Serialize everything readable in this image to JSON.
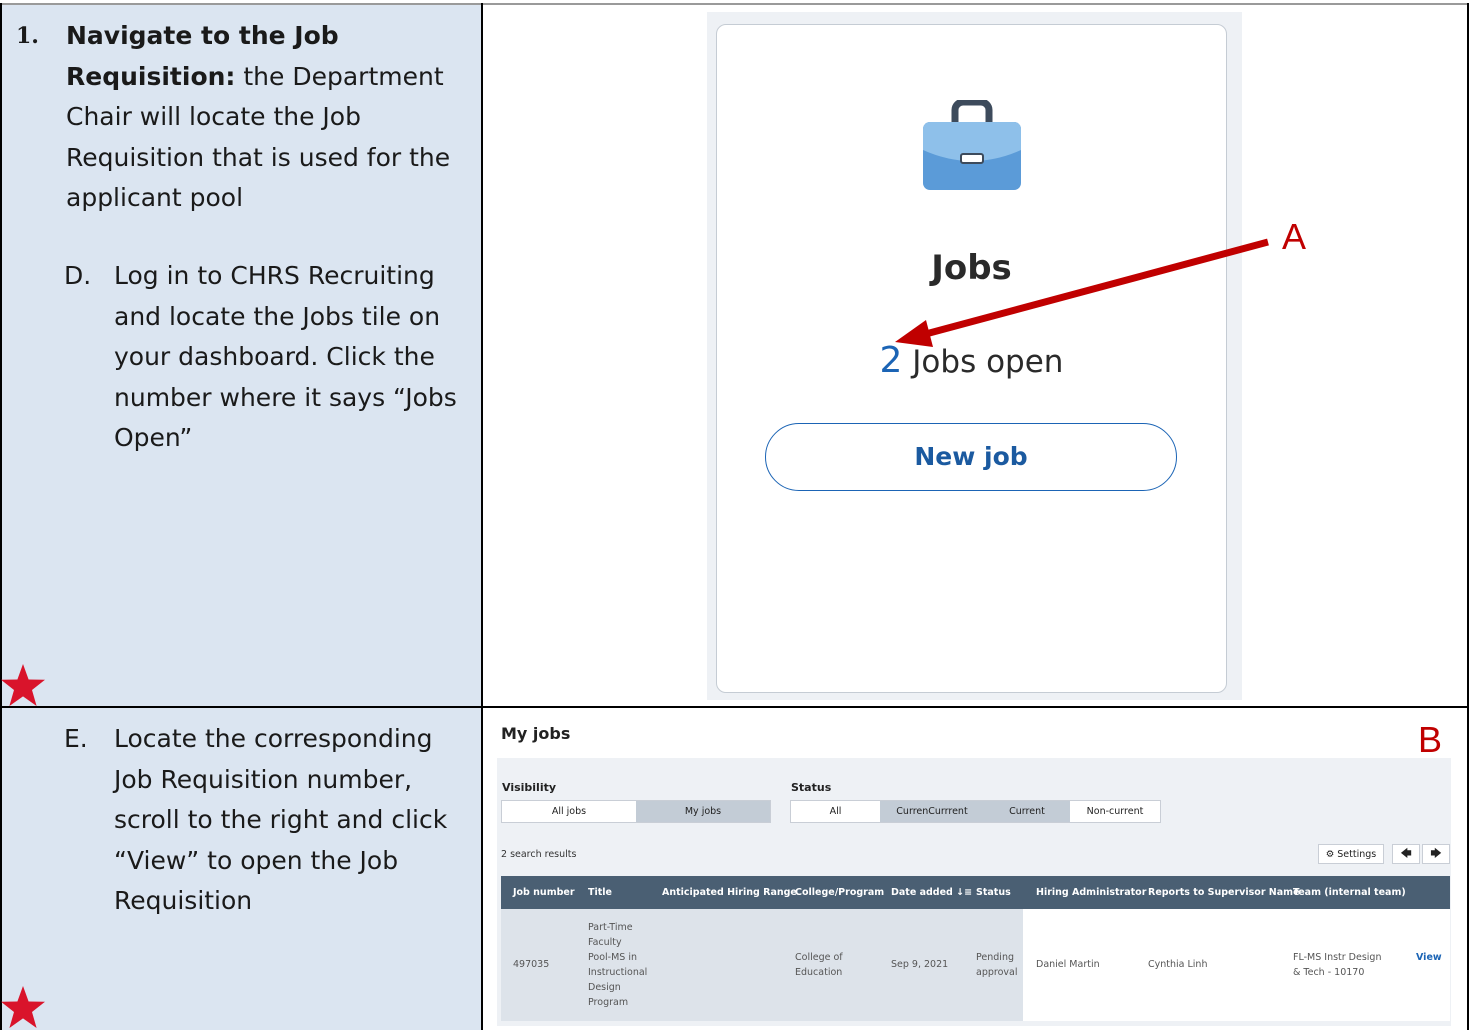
{
  "step": {
    "number": "1.",
    "title": "Navigate to the Job Requisition:",
    "description": " the Department Chair will locate the Job Requisition that is used for the applicant pool"
  },
  "sub_d": {
    "letter": "D.",
    "text": "Log in to CHRS Recruiting and locate the Jobs tile on your dashboard. Click the number where it says “Jobs Open”"
  },
  "sub_e": {
    "letter": "E.",
    "text": "Locate the corresponding Job Requisition number, scroll to the right and click “View” to open the Job Requisition"
  },
  "jobs_tile": {
    "title": "Jobs",
    "count": "2",
    "count_label": " Jobs open",
    "new_job_label": "New job",
    "icon": "briefcase-icon"
  },
  "callouts": {
    "a": "A",
    "b": "B"
  },
  "my_jobs": {
    "title": "My jobs",
    "visibility_label": "Visibility",
    "visibility_options": [
      "All jobs",
      "My jobs"
    ],
    "status_label": "Status",
    "status_options": [
      "All",
      "CurrenCurrrent",
      "Current",
      "Non-current"
    ],
    "results_text": "2 search results",
    "settings_label": "Settings",
    "prev_icon": "arrow-left-icon",
    "next_icon": "arrow-right-icon",
    "columns": [
      "Job number",
      "Title",
      "Anticipated Hiring Range",
      "College/Program",
      "Date added",
      "Status",
      "Hiring Administrator",
      "Reports to Supervisor Name",
      "Team (internal team)"
    ],
    "sort_icon": "sort-desc-icon",
    "rows": [
      {
        "job_number": "497035",
        "title_lines": [
          "Part-Time",
          "Faculty",
          "Pool-MS in",
          "Instructional",
          "Design",
          "Program"
        ],
        "hiring_range": "",
        "college_lines": [
          "College of",
          "Education"
        ],
        "date_added": "Sep 9, 2021",
        "status_lines": [
          "Pending",
          "approval"
        ],
        "hiring_admin": "Daniel Martin",
        "supervisor": "Cynthia Linh",
        "team_lines": [
          "FL-MS Instr Design",
          "& Tech - 10170"
        ],
        "action": "View"
      }
    ]
  },
  "colors": {
    "accent": "#1b64b5",
    "callout": "#c00000",
    "table_header": "#4a5f73",
    "left_cell": "#dbe5f1"
  }
}
